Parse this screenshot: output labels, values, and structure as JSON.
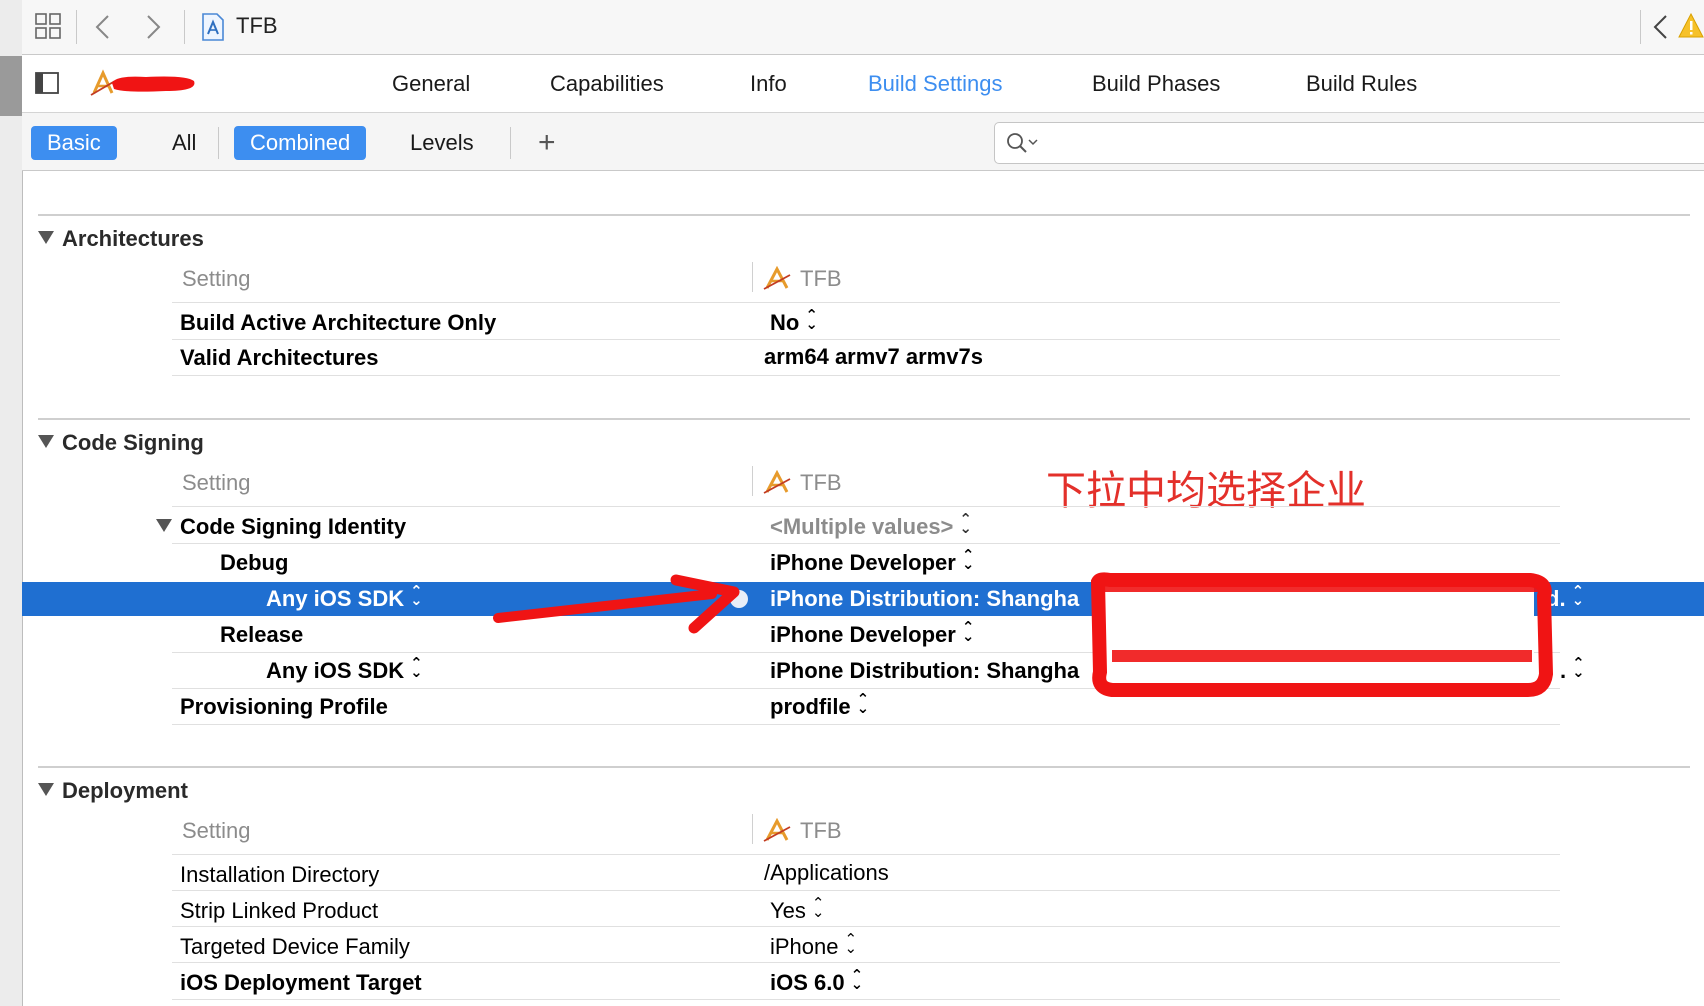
{
  "window": {
    "title": "TFB"
  },
  "tabs": [
    {
      "label": "General"
    },
    {
      "label": "Capabilities"
    },
    {
      "label": "Info"
    },
    {
      "label": "Build Settings"
    },
    {
      "label": "Build Phases"
    },
    {
      "label": "Build Rules"
    }
  ],
  "active_tab": "Build Settings",
  "filters": {
    "basic": "Basic",
    "all": "All",
    "combined": "Combined",
    "levels": "Levels",
    "add": "+"
  },
  "setting_label": "Setting",
  "target_label": "TFB",
  "sections": {
    "architectures": {
      "title": "Architectures",
      "rows": [
        {
          "key": "Build Active Architecture Only",
          "value": "No"
        },
        {
          "key": "Valid Architectures",
          "value": "arm64 armv7 armv7s"
        }
      ]
    },
    "code_signing": {
      "title": "Code Signing",
      "rows": [
        {
          "key": "Code Signing Identity",
          "value": "<Multiple values>"
        },
        {
          "key": "Debug",
          "value": "iPhone Developer"
        },
        {
          "key": "Any iOS SDK",
          "value": "iPhone Distribution: Shangha"
        },
        {
          "key": "Release",
          "value": "iPhone Developer"
        },
        {
          "key": "Any iOS SDK",
          "value": "iPhone Distribution: Shangha"
        },
        {
          "key": "Provisioning Profile",
          "value": "prodfile"
        }
      ],
      "truncated_tail_1": "d.",
      "truncated_tail_2": "."
    },
    "deployment": {
      "title": "Deployment",
      "rows": [
        {
          "key": "Installation Directory",
          "value": "/Applications"
        },
        {
          "key": "Strip Linked Product",
          "value": "Yes"
        },
        {
          "key": "Targeted Device Family",
          "value": "iPhone"
        },
        {
          "key": "iOS Deployment Target",
          "value": "iOS 6.0"
        }
      ]
    }
  },
  "annotation": {
    "text": "下拉中均选择企业",
    "color": "#e3302a"
  },
  "colors": {
    "accent": "#3d8ef0",
    "selection": "#1f6fd1",
    "annotation_red": "#e3302a"
  }
}
